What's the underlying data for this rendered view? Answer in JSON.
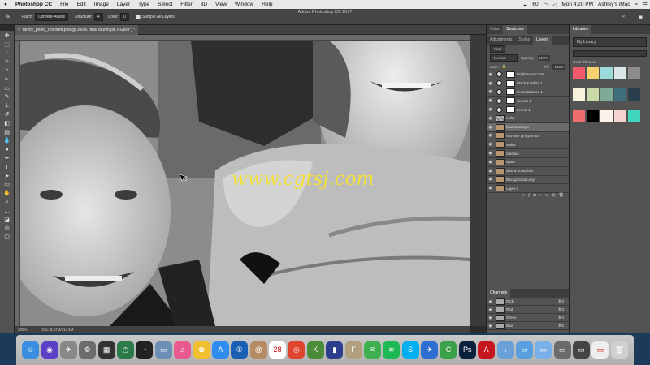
{
  "menubar": {
    "apple": "",
    "app": "Photoshop CC",
    "items": [
      "File",
      "Edit",
      "Image",
      "Layer",
      "Type",
      "Select",
      "Filter",
      "3D",
      "View",
      "Window",
      "Help"
    ],
    "battery": "60",
    "clock": "Mon 4:20 PM",
    "user": "Ashley's iMac"
  },
  "window_title": "Adobe Photoshop CC 2017",
  "options": {
    "patch_label": "Patch:",
    "patch_value": "Content-Aware",
    "structure_label": "Structure:",
    "structure_value": "4",
    "color_label": "Color:",
    "color_value": "0",
    "sample_label": "Sample All Layers"
  },
  "document": {
    "tab": "family_photo_restored.psd @ 200% (final touchups, RGB/8*) *",
    "zoom": "200%",
    "doc_size": "Doc: 8.57M/114.5M"
  },
  "watermark": "www.cgtsj.com",
  "panels": {
    "top_tabs": [
      "Color",
      "Swatches"
    ],
    "mid_tabs": [
      "Adjustments",
      "Styles",
      "Layers"
    ],
    "kind": "Kind",
    "blend": "Normal",
    "opacity_label": "Opacity:",
    "opacity": "100%",
    "lock_label": "Lock:",
    "fill_label": "Fill:",
    "fill": "100%",
    "layers": [
      {
        "name": "Brightness/Contr...",
        "type": "adj"
      },
      {
        "name": "Black & White 1",
        "type": "adj"
      },
      {
        "name": "Color Balance 1",
        "type": "adj"
      },
      {
        "name": "Curves 1",
        "type": "adj"
      },
      {
        "name": "Levels 1",
        "type": "adj"
      },
      {
        "name": "collar",
        "type": "pattern"
      },
      {
        "name": "final touchups",
        "type": "photo",
        "selected": true
      },
      {
        "name": "recreate pin (Donna)",
        "type": "photo"
      },
      {
        "name": "stains",
        "type": "photo"
      },
      {
        "name": "creases",
        "type": "photo"
      },
      {
        "name": "spots",
        "type": "photo"
      },
      {
        "name": "dust & scratches",
        "type": "photo"
      },
      {
        "name": "Background copy",
        "type": "photo"
      },
      {
        "name": "Layer 0",
        "type": "photo"
      }
    ],
    "channels_title": "Channels",
    "channels": [
      {
        "name": "RGB",
        "shortcut": "⌘2"
      },
      {
        "name": "Red",
        "shortcut": "⌘3"
      },
      {
        "name": "Green",
        "shortcut": "⌘4"
      },
      {
        "name": "Blue",
        "shortcut": "⌘5"
      }
    ]
  },
  "libraries": {
    "title": "Libraries",
    "library": "My Library",
    "section": "Color Themes",
    "themes": [
      [
        "#f05a6a",
        "#f5d26b",
        "#9adbd9",
        "#d8e6e6",
        "#8c8c8c"
      ],
      [
        "#f6f2dc",
        "#c9d9a8",
        "#7faa98",
        "#3f6f7d",
        "#2a3d4a"
      ],
      [
        "#ee6d6d",
        "#000000",
        "#fbf2ea",
        "#f4d2cf",
        "#3fd6bd"
      ]
    ]
  },
  "dock": {
    "apps": [
      {
        "name": "finder",
        "color": "#3b8de0",
        "glyph": "☺"
      },
      {
        "name": "siri",
        "color": "#5b3fc4",
        "glyph": "◉"
      },
      {
        "name": "launchpad",
        "color": "#888888",
        "glyph": "✈"
      },
      {
        "name": "system-preferences",
        "color": "#6d6d6d",
        "glyph": "⚙"
      },
      {
        "name": "activity-monitor",
        "color": "#333333",
        "glyph": "▦"
      },
      {
        "name": "time-machine",
        "color": "#2a7a4a",
        "glyph": "◷"
      },
      {
        "name": "dashboard",
        "color": "#222222",
        "glyph": "◔"
      },
      {
        "name": "preview",
        "color": "#6b8fb5",
        "glyph": "▭"
      },
      {
        "name": "itunes",
        "color": "#e85a90",
        "glyph": "♫"
      },
      {
        "name": "photos",
        "color": "#f0c030",
        "glyph": "✿"
      },
      {
        "name": "app-store",
        "color": "#2f8df0",
        "glyph": "A"
      },
      {
        "name": "1password",
        "color": "#1a5fb4",
        "glyph": "①"
      },
      {
        "name": "contacts",
        "color": "#b58b62",
        "glyph": "@"
      },
      {
        "name": "calendar",
        "color": "#ffffff",
        "glyph": "28"
      },
      {
        "name": "chrome",
        "color": "#e0462f",
        "glyph": "◎"
      },
      {
        "name": "keynote",
        "color": "#4a8c3a",
        "glyph": "K"
      },
      {
        "name": "books",
        "color": "#2c3e8c",
        "glyph": "▮"
      },
      {
        "name": "fontbook",
        "color": "#b0a080",
        "glyph": "F"
      },
      {
        "name": "messages",
        "color": "#3fb04f",
        "glyph": "✉"
      },
      {
        "name": "spotify",
        "color": "#1db954",
        "glyph": "≋"
      },
      {
        "name": "skype",
        "color": "#00aff0",
        "glyph": "S"
      },
      {
        "name": "airmail",
        "color": "#2d6fd0",
        "glyph": "✈"
      },
      {
        "name": "camtasia",
        "color": "#3aa04a",
        "glyph": "C"
      },
      {
        "name": "photoshop",
        "color": "#0a1f3c",
        "glyph": "Ps"
      },
      {
        "name": "acrobat",
        "color": "#c4161c",
        "glyph": "Λ"
      },
      {
        "name": "downloads",
        "color": "#6aa0d8",
        "glyph": "↓"
      },
      {
        "name": "folder",
        "color": "#5aa0e0",
        "glyph": "▭"
      },
      {
        "name": "documents",
        "color": "#7ab0e8",
        "glyph": "▭"
      },
      {
        "name": "screenshot",
        "color": "#6a6a6a",
        "glyph": "▭"
      },
      {
        "name": "stack",
        "color": "#444444",
        "glyph": "▭"
      },
      {
        "name": "files",
        "color": "#eeeeee",
        "glyph": "▭"
      },
      {
        "name": "trash",
        "color": "#d0d0d0",
        "glyph": "🗑"
      }
    ]
  }
}
